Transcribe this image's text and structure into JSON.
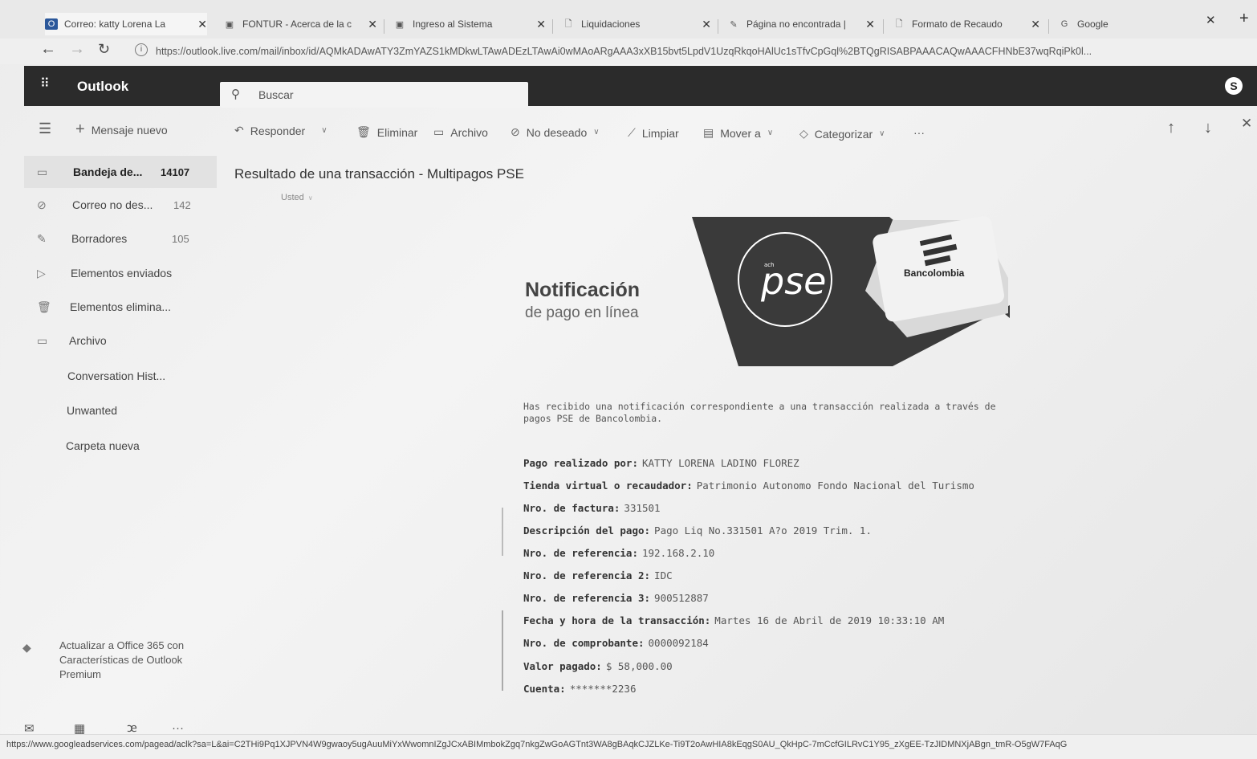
{
  "browser": {
    "tabs": [
      {
        "title": "Correo: katty Lorena La"
      },
      {
        "title": "FONTUR - Acerca de la c"
      },
      {
        "title": "Ingreso al Sistema"
      },
      {
        "title": "Liquidaciones"
      },
      {
        "title": "Página no encontrada |"
      },
      {
        "title": "Formato de Recaudo"
      },
      {
        "title": "Google"
      }
    ],
    "url": "https://outlook.live.com/mail/inbox/id/AQMkADAwATY3ZmYAZS1kMDkwLTAwADEzLTAwAi0wMAoARgAAA3xXB15bvt5LpdV1UzqRkqoHAlUc1sTfvCpGql%2BTQgRISABPAAACAQwAAACFHNbE37wqRqiPk0l...",
    "status_url": "https://www.googleadservices.com/pagead/aclk?sa=L&ai=C2THi9Pq1XJPVN4W9gwaoy5ugAuuMiYxWwomnIZgJCxABIMmbokZgq7nkgZwGoAGTnt3WA8gBAqkCJZLKe-Ti9T2oAwHIA8kEqgS0AU_QkHpC-7mCcfGILRvC1Y95_zXgEE-TzJIDMNXjABgn_tmR-O5gW7FAqG"
  },
  "outlook": {
    "brand": "Outlook",
    "search_placeholder": "Buscar",
    "avatar_initial": "S"
  },
  "commands": {
    "new_message": "Mensaje nuevo",
    "reply": "Responder",
    "delete": "Eliminar",
    "archive": "Archivo",
    "junk": "No deseado",
    "sweep": "Limpiar",
    "move": "Mover a",
    "categorize": "Categorizar",
    "more": "···"
  },
  "folders": [
    {
      "name": "Bandeja de...",
      "count": "14107"
    },
    {
      "name": "Correo no des...",
      "count": "142"
    },
    {
      "name": "Borradores",
      "count": "105"
    },
    {
      "name": "Elementos enviados",
      "count": ""
    },
    {
      "name": "Elementos elimina...",
      "count": ""
    },
    {
      "name": "Archivo",
      "count": ""
    },
    {
      "name": "Conversation Hist...",
      "count": ""
    },
    {
      "name": "Unwanted",
      "count": ""
    },
    {
      "name": "Carpeta nueva",
      "count": ""
    }
  ],
  "upsell": "Actualizar a Office 365 con Características de Outlook Premium",
  "message": {
    "subject": "Resultado de una transacción - Multipagos PSE",
    "sender": "Usted",
    "title": "Notificación",
    "subtitle": "de pago en línea",
    "pse_logo": "pse",
    "pse_small": "ach",
    "bank": "Bancolombia",
    "intro": "Has recibido una notificación correspondiente a una transacción realizada a través de pagos PSE de Bancolombia.",
    "fields": [
      {
        "label": "Pago realizado por:",
        "value": "KATTY LORENA LADINO FLOREZ"
      },
      {
        "label": "Tienda virtual o recaudador:",
        "value": "Patrimonio Autonomo Fondo Nacional del Turismo"
      },
      {
        "label": "Nro. de factura:",
        "value": "331501"
      },
      {
        "label": "Descripción del pago:",
        "value": "Pago Liq No.331501 A?o 2019 Trim. 1."
      },
      {
        "label": "Nro. de referencia:",
        "value": "192.168.2.10"
      },
      {
        "label": "Nro. de referencia 2:",
        "value": "IDC"
      },
      {
        "label": "Nro. de referencia 3:",
        "value": "900512887"
      },
      {
        "label": "Fecha y hora de la transacción:",
        "value": "Martes 16 de Abril de 2019 10:33:10 AM"
      },
      {
        "label": "Nro. de comprobante:",
        "value": "0000092184"
      },
      {
        "label": "Valor pagado:",
        "value": "$ 58,000.00"
      },
      {
        "label": "Cuenta:",
        "value": "*******2236"
      }
    ]
  }
}
